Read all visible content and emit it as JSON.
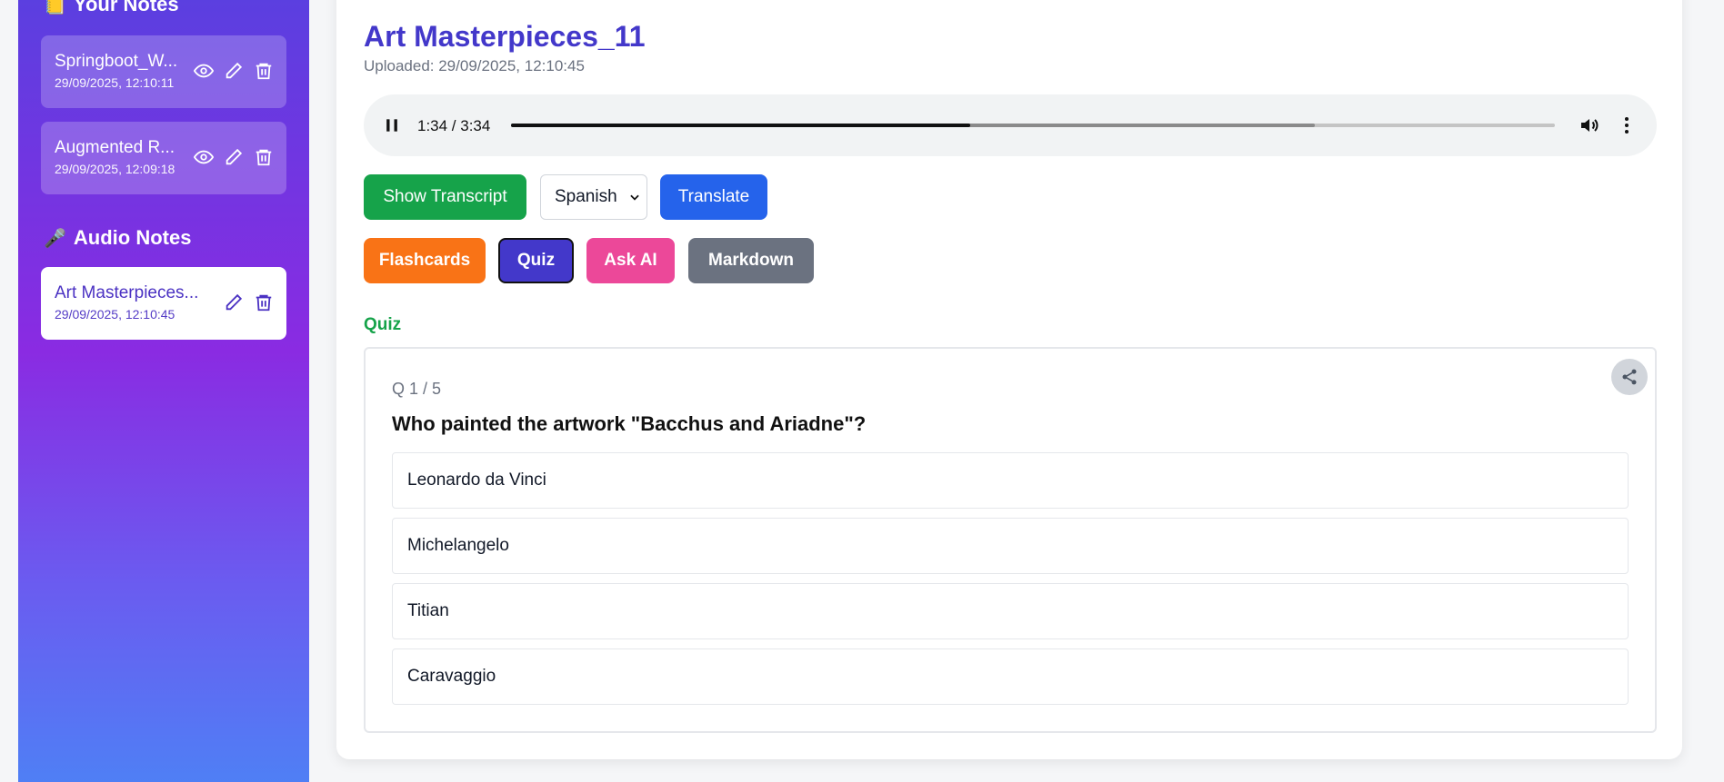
{
  "sidebar": {
    "your_notes_title": "Your Notes",
    "your_notes": [
      {
        "title": "Springboot_W...",
        "date": "29/09/2025, 12:10:11"
      },
      {
        "title": "Augmented R...",
        "date": "29/09/2025, 12:09:18"
      }
    ],
    "audio_notes_title": "Audio Notes",
    "audio_notes": [
      {
        "title": "Art Masterpieces...",
        "date": "29/09/2025, 12:10:45"
      }
    ]
  },
  "main": {
    "title": "Art Masterpieces_11",
    "uploaded": "Uploaded: 29/09/2025, 12:10:45",
    "player": {
      "time": "1:34 / 3:34",
      "played_fraction": 0.44,
      "buffered_fraction": 0.77
    },
    "buttons": {
      "show_transcript": "Show Transcript",
      "language": "Spanish",
      "translate": "Translate",
      "flashcards": "Flashcards",
      "quiz": "Quiz",
      "ask_ai": "Ask AI",
      "markdown": "Markdown"
    },
    "quiz": {
      "heading": "Quiz",
      "counter": "Q 1 / 5",
      "question": "Who painted the artwork \"Bacchus and Ariadne\"?",
      "options": [
        "Leonardo da Vinci",
        "Michelangelo",
        "Titian",
        "Caravaggio"
      ]
    }
  },
  "colors": {
    "accent": "#4338ca",
    "green": "#16a34a",
    "blue": "#2563eb",
    "orange": "#f97316",
    "pink": "#ec4899",
    "gray": "#6b7280"
  }
}
